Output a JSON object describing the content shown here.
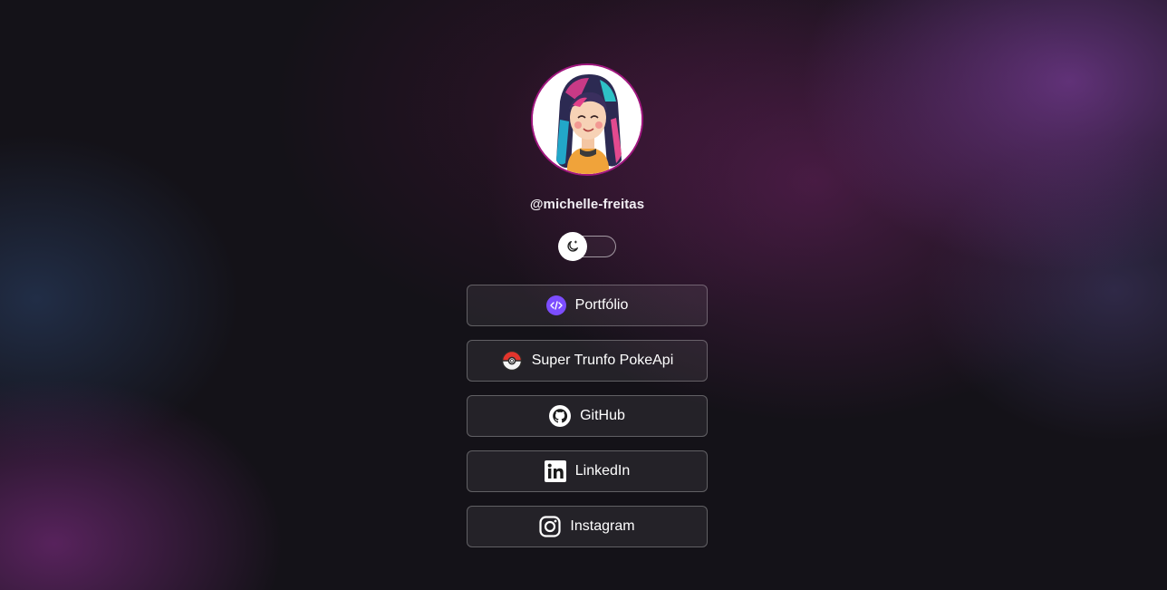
{
  "profile": {
    "username": "@michelle-freitas",
    "avatar_alt": "avatar illustration"
  },
  "theme_toggle": {
    "icon": "moon-icon",
    "state": "dark"
  },
  "links": [
    {
      "label": "Portfólio",
      "icon": "code-icon"
    },
    {
      "label": "Super Trunfo PokeApi",
      "icon": "pokeball-icon"
    },
    {
      "label": "GitHub",
      "icon": "github-icon"
    },
    {
      "label": "LinkedIn",
      "icon": "linkedin-icon"
    },
    {
      "label": "Instagram",
      "icon": "instagram-icon"
    }
  ],
  "colors": {
    "avatar_border": "#a0167f",
    "portfolio_icon": "#7c4dff",
    "background": "#141218"
  }
}
